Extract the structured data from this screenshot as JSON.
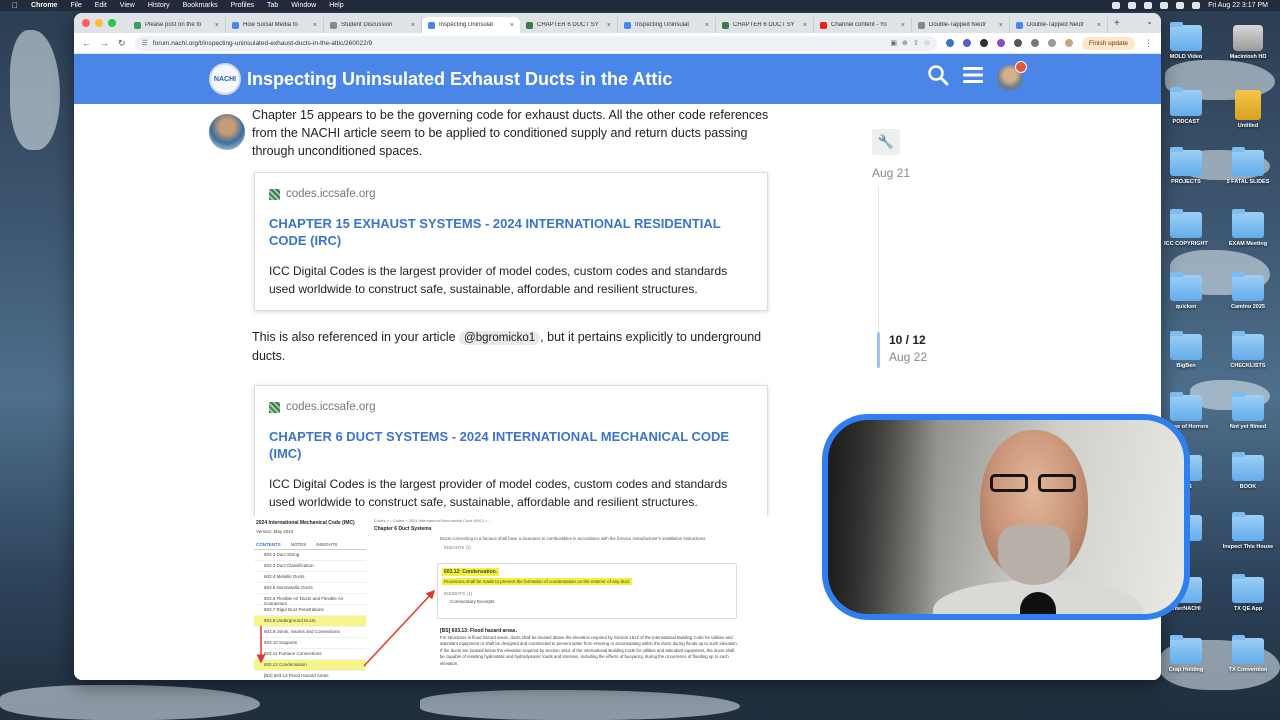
{
  "menubar": {
    "app_name": "Chrome",
    "menus": [
      "File",
      "Edit",
      "View",
      "History",
      "Bookmarks",
      "Profiles",
      "Tab",
      "Window",
      "Help"
    ],
    "clock": "Fri Aug 22  3:17 PM"
  },
  "browser": {
    "tabs": [
      {
        "label": "Please post on the fo",
        "color": "#3b9e5b"
      },
      {
        "label": "How Social Media fo",
        "color": "#4a86e8"
      },
      {
        "label": "Student Discussion",
        "color": "#888888"
      },
      {
        "label": "Inspecting Uninsulat",
        "color": "#4a86e8",
        "active": true
      },
      {
        "label": "CHAPTER 6 DUCT SY",
        "color": "#3d7a4d"
      },
      {
        "label": "Inspecting Uninsulat",
        "color": "#4a86e8"
      },
      {
        "label": "CHAPTER 6 DUCT SY",
        "color": "#3d7a4d"
      },
      {
        "label": "Channel content - Yo",
        "color": "#e62117"
      },
      {
        "label": "Double-Tapped Neutr",
        "color": "#888888"
      },
      {
        "label": "Double-Tapped Neutr",
        "color": "#4a86e8"
      }
    ],
    "url": "forum.nachi.org/t/inspecting-uninsulated-exhaust-ducts-in-the-attic/260022/9",
    "finish_update": "Finish update"
  },
  "site": {
    "logo_text": "NACHI",
    "title": "Inspecting Uninsulated Exhaust Ducts in the Attic"
  },
  "post": {
    "para1": "Chapter 15 appears to be the governing code for exhaust ducts. All the other code references from the NACHI article seem to be applied to conditioned supply and return ducts passing through unconditioned spaces.",
    "onebox1": {
      "source": "codes.iccsafe.org",
      "title": "CHAPTER 15 EXHAUST SYSTEMS - 2024 INTERNATIONAL RESIDENTIAL CODE (IRC)",
      "description": "ICC Digital Codes is the largest provider of model codes, custom codes and standards used worldwide to construct safe, sustainable, affordable and resilient structures."
    },
    "para2_before": "This is also referenced in your article",
    "mention": "@bgromicko1",
    "para2_after": ", but it pertains explicitly to underground ducts.",
    "onebox2": {
      "source": "codes.iccsafe.org",
      "title": "CHAPTER 6 DUCT SYSTEMS - 2024 INTERNATIONAL MECHANICAL CODE (IMC)",
      "description": "ICC Digital Codes is the largest provider of model codes, custom codes and standards used worldwide to construct safe, sustainable, affordable and resilient structures."
    }
  },
  "embedded": {
    "left_title": "2024 International Mechanical Code (IMC)",
    "left_version": "Version: May 2024",
    "left_tabs": [
      "CONTENTS",
      "NOTES",
      "INSIGHTS"
    ],
    "toc": [
      "603.3 Duct Sizing",
      "603.3 Duct Classification",
      "603.4 Metallic Ducts",
      "603.5 Nonmetallic Ducts",
      "603.6 Flexible Air Ducts and Flexible Air Connectors",
      "603.7 Rigid Duct Penetrations",
      "603.8 Underground Ducts",
      "603.9 Joints, Seams and Connections",
      "603.10 Supports",
      "603.11 Furnace Connections",
      "603.12 Condensation",
      "[BS] 603.13 Flood Hazard Areas"
    ],
    "crumbs": "Codes > I-Codes > 2024 International Mechanical Code (IMC) > ...",
    "chapter": "Chapter 6 Duct Systems",
    "furnace_line": "Ducts connecting to a furnace shall have a clearance to combustibles in accordance with the furnace manufacturer's installation instructions.",
    "insights_label": "INSIGHTS (1)",
    "condensation_title": "603.12: Condensation.",
    "condensation_text": "Provisions shall be made to prevent the formation of condensation on the exterior of any duct.",
    "commentary_label": "Commentary Excerpts",
    "flood_title": "[BS] 603.13: Flood hazard areas.",
    "flood_text": "For structures in flood hazard areas, ducts shall be located above the elevation required by Section 1612 of the International Building Code for utilities and attendant equipment or shall be designed and constructed to prevent water from entering or accumulating within the ducts during floods up to such elevation. If the ducts are located below the elevation required by Section 1612 of the International Building Code for utilities and attendant equipment, the ducts shall be capable of resisting hydrostatic and hydrodynamic loads and stresses, including the effects of buoyancy, during the occurrence of flooding up to such elevation."
  },
  "timeline": {
    "start_date": "Aug 21",
    "position": "10 / 12",
    "current_date": "Aug 22"
  },
  "desktop": {
    "left_column": [
      "MOLD Video",
      "PODCAST",
      "PROJECTS",
      "ICC COPYRIGHT",
      "quicken",
      "BigBen",
      "House of Horrors",
      "ARS",
      "",
      "InterNACHI",
      "Crap Holding"
    ],
    "right_column": [
      "Macintosh HD",
      "Untitled",
      "5 FATAL SLIDES",
      "EXAM Meeting",
      "Camino 2025",
      "CHECKLISTS",
      "Not yet filmed",
      "BOOK",
      "Inspect This House",
      "TX QE App",
      "TX Convention"
    ]
  }
}
